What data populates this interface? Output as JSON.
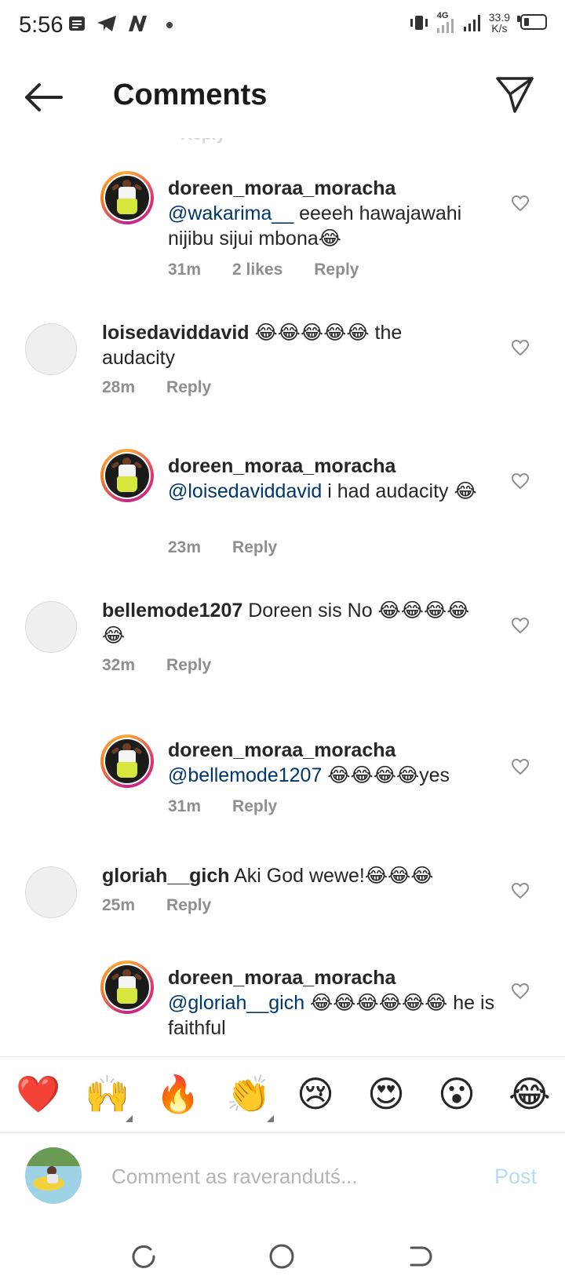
{
  "status_bar": {
    "time": "5:56",
    "network": "4G",
    "speed_value": "33.9",
    "speed_unit": "K/s"
  },
  "header": {
    "title": "Comments"
  },
  "partial_top_text": "Reply",
  "comments": [
    {
      "user": "doreen_moraa_moracha",
      "mention": "@wakarima__",
      "body": " eeeeh hawajawahi nijibu sijui mbona😂",
      "time": "31m",
      "likes": "2 likes",
      "reply": "Reply",
      "is_reply": true
    },
    {
      "user": "loisedaviddavid",
      "mention": "",
      "body": " 😂😂😂😂😂 the audacity",
      "time": "28m",
      "likes": "",
      "reply": "Reply",
      "is_reply": false
    },
    {
      "user": "doreen_moraa_moracha",
      "mention": "@loisedaviddavid",
      "body": " i had audacity 😂",
      "time": "23m",
      "likes": "",
      "reply": "Reply",
      "is_reply": true
    },
    {
      "user": "bellemode1207",
      "mention": "",
      "body": " Doreen sis No 😂😂😂😂😂",
      "time": "32m",
      "likes": "",
      "reply": "Reply",
      "is_reply": false
    },
    {
      "user": "doreen_moraa_moracha",
      "mention": "@bellemode1207",
      "body": " 😂😂😂😂yes",
      "time": "31m",
      "likes": "",
      "reply": "Reply",
      "is_reply": true
    },
    {
      "user": "gloriah__gich",
      "mention": "",
      "body": " Aki God wewe!😂😂😂",
      "time": "25m",
      "likes": "",
      "reply": "Reply",
      "is_reply": false
    },
    {
      "user": "doreen_moraa_moracha",
      "mention": "@gloriah__gich",
      "body": " 😂😂😂😂😂😂 he is faithful",
      "time": "",
      "likes": "",
      "reply": "",
      "is_reply": true
    }
  ],
  "emoji_bar": [
    "❤️",
    "🙌",
    "🔥",
    "👏",
    "😢",
    "😍",
    "😮",
    "😂"
  ],
  "composer": {
    "placeholder": "Comment as raverandutś...",
    "post_label": "Post"
  },
  "icons": {
    "back": "arrow-left-icon",
    "send": "paper-plane-icon",
    "heart": "heart-outline-icon",
    "nav": [
      "recents-icon",
      "home-icon",
      "back-nav-icon"
    ]
  },
  "colors": {
    "mention": "#00376b",
    "meta": "#8e8e8e",
    "post": "#b3dbff",
    "heart_emoji": "#e0222f"
  }
}
